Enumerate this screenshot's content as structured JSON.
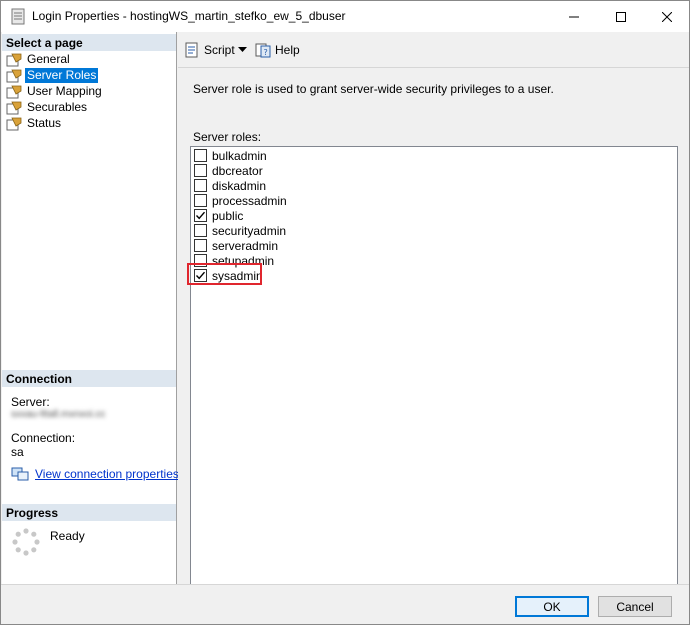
{
  "window": {
    "title": "Login Properties - hostingWS_martin_stefko_ew_5_dbuser"
  },
  "left_pane": {
    "select_page_header": "Select a page",
    "pages": [
      {
        "label": "General",
        "selected": false
      },
      {
        "label": "Server Roles",
        "selected": true
      },
      {
        "label": "User Mapping",
        "selected": false
      },
      {
        "label": "Securables",
        "selected": false
      },
      {
        "label": "Status",
        "selected": false
      }
    ],
    "connection_header": "Connection",
    "server_label": "Server:",
    "server_value": "sxxau-lttall.mxnxoi.cc",
    "connection_label": "Connection:",
    "connection_value": "sa",
    "view_connection_link": "View connection properties",
    "progress_header": "Progress",
    "progress_status": "Ready"
  },
  "toolbar": {
    "script_label": "Script",
    "help_label": "Help"
  },
  "content": {
    "description": "Server role is used to grant server-wide security privileges to a user.",
    "roles_label": "Server roles:",
    "roles": [
      {
        "name": "bulkadmin",
        "checked": false
      },
      {
        "name": "dbcreator",
        "checked": false
      },
      {
        "name": "diskadmin",
        "checked": false
      },
      {
        "name": "processadmin",
        "checked": false
      },
      {
        "name": "public",
        "checked": true
      },
      {
        "name": "securityadmin",
        "checked": false
      },
      {
        "name": "serveradmin",
        "checked": false
      },
      {
        "name": "setupadmin",
        "checked": false
      },
      {
        "name": "sysadmin",
        "checked": true
      }
    ]
  },
  "buttons": {
    "ok_label": "OK",
    "cancel_label": "Cancel"
  },
  "colors": {
    "selection": "#0078d7",
    "highlight_box": "#e0262e",
    "section_header": "#dde6ef"
  }
}
